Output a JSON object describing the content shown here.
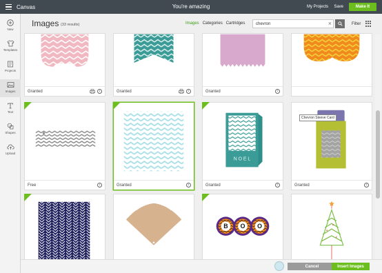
{
  "topbar": {
    "app_title": "Canvas",
    "tagline": "You're amazing",
    "my_projects": "My Projects",
    "save": "Save",
    "make_it": "Make It"
  },
  "sidebar": {
    "items": [
      {
        "label": "New",
        "icon": "plus-circle-icon"
      },
      {
        "label": "Templates",
        "icon": "shirt-icon"
      },
      {
        "label": "Projects",
        "icon": "projects-icon"
      },
      {
        "label": "Images",
        "icon": "image-icon"
      },
      {
        "label": "Text",
        "icon": "text-icon"
      },
      {
        "label": "Shapes",
        "icon": "shapes-icon"
      },
      {
        "label": "Upload",
        "icon": "upload-cloud-icon"
      }
    ]
  },
  "header": {
    "title": "Images",
    "result_count": "(33 results)",
    "tabs": [
      {
        "label": "Images",
        "active": true
      },
      {
        "label": "Categories",
        "active": false
      },
      {
        "label": "Cartridges",
        "active": false
      }
    ],
    "search_value": "chevron",
    "filter_label": "Filter"
  },
  "cards": [
    {
      "status": "Granted",
      "print": true
    },
    {
      "status": "Granted",
      "print": true
    },
    {
      "status": "Granted",
      "print": false
    },
    {
      "status": "",
      "print": false
    },
    {
      "status": "Free",
      "print": false
    },
    {
      "status": "Granted",
      "print": false
    },
    {
      "status": "Granted",
      "print": false
    },
    {
      "status": "Granted",
      "print": false
    },
    {
      "status": "",
      "print": false
    },
    {
      "status": "",
      "print": false
    },
    {
      "status": "",
      "print": false
    },
    {
      "status": "",
      "print": false
    }
  ],
  "card_text": {
    "noel": "N O E L",
    "boo": [
      "B",
      "O",
      "O"
    ]
  },
  "tooltip": "Chevron Sleeve Card",
  "footer": {
    "cancel": "Cancel",
    "insert": "Insert Images"
  },
  "colors": {
    "accent": "#6bbe1e",
    "topbar": "#414a51"
  }
}
